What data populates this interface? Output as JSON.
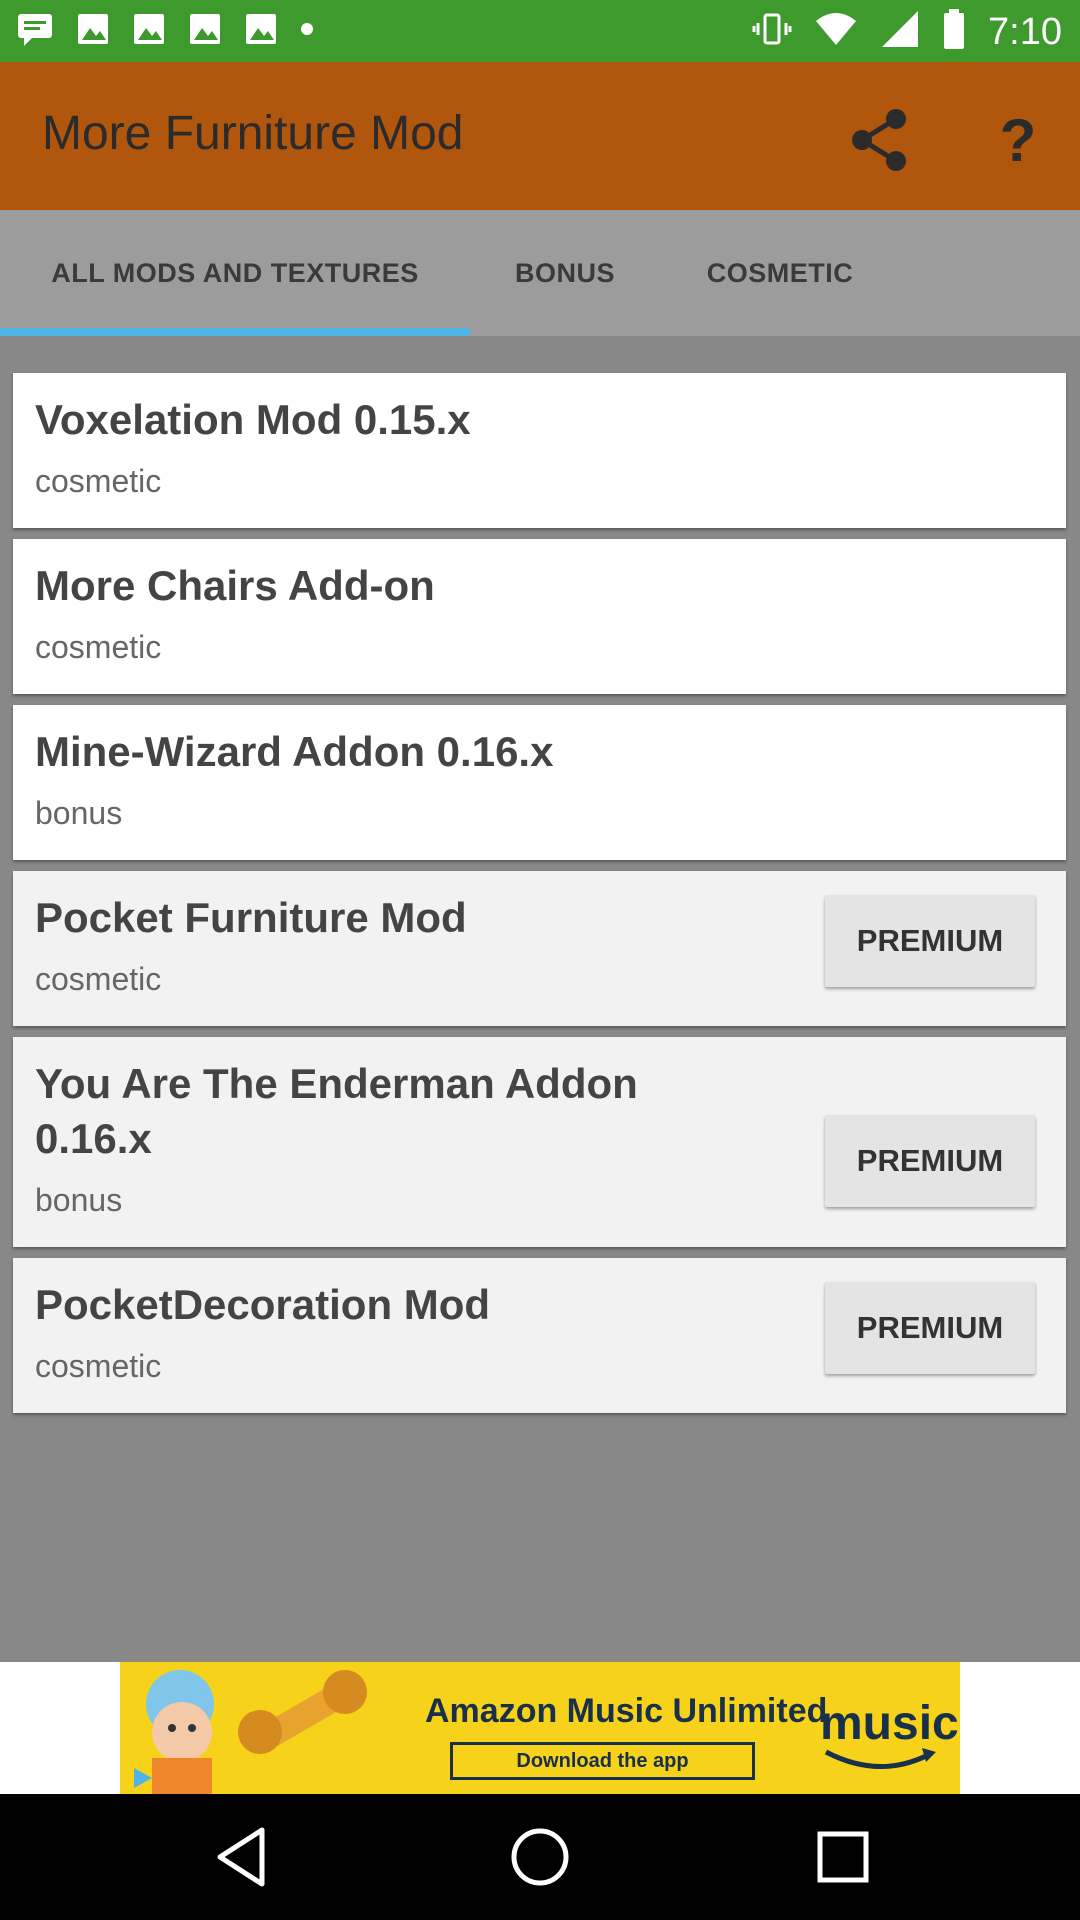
{
  "status_bar": {
    "time": "7:10",
    "icons": [
      "message-icon",
      "image-icon",
      "image-icon",
      "image-icon",
      "image-icon",
      "dot-icon",
      "vibrate-icon",
      "wifi-icon",
      "signal-icon",
      "battery-icon"
    ]
  },
  "app_bar": {
    "title": "More Furniture Mod",
    "share_icon": "share-icon",
    "help_icon": "help-icon",
    "help_glyph": "?"
  },
  "tabs": [
    {
      "label": "ALL MODS AND TEXTURES",
      "selected": true
    },
    {
      "label": "BONUS",
      "selected": false
    },
    {
      "label": "COSMETIC",
      "selected": false
    }
  ],
  "items": [
    {
      "title_lines": [
        "Voxelation Mod 0.15.x"
      ],
      "category": "cosmetic",
      "premium": false
    },
    {
      "title_lines": [
        "More Chairs Add-on"
      ],
      "category": "cosmetic",
      "premium": false
    },
    {
      "title_lines": [
        "Mine-Wizard Addon 0.16.x"
      ],
      "category": "bonus",
      "premium": false
    },
    {
      "title_lines": [
        "Pocket Furniture Mod"
      ],
      "category": "cosmetic",
      "premium": true
    },
    {
      "title_lines": [
        "You Are The Enderman Addon",
        "0.16.x"
      ],
      "category": "bonus",
      "premium": true
    },
    {
      "title_lines": [
        "PocketDecoration Mod"
      ],
      "category": "cosmetic",
      "premium": true
    }
  ],
  "premium_label": "PREMIUM",
  "ad": {
    "headline": "Amazon Music Unlimited",
    "cta": "Download the app",
    "brand": "music"
  },
  "nav_bar": {
    "buttons": [
      "back-icon",
      "home-icon",
      "recents-icon"
    ]
  },
  "colors": {
    "status_bar": "#3f9a2d",
    "app_bar": "#b1560d",
    "tab_bar": "#9c9c9c",
    "tab_indicator": "#4eb3e6",
    "background": "#888888",
    "ad_background": "#f6d21a"
  }
}
